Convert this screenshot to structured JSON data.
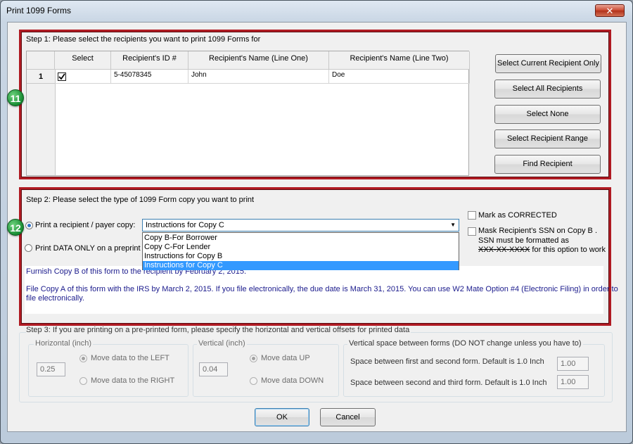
{
  "window": {
    "title": "Print 1099 Forms",
    "close_glyph": "✕"
  },
  "step1": {
    "label": "Step 1: Please select the recipients you want to print 1099 Forms for",
    "columns": [
      "Select",
      "Recipient's ID #",
      "Recipient's Name (Line One)",
      "Recipient's Name (Line Two)"
    ],
    "rows": [
      {
        "number": "1",
        "selected": true,
        "id": "5-45078345",
        "name_line_one": "John",
        "name_line_two": "Doe"
      }
    ],
    "buttons": {
      "select_current": "Select Current Recipient Only",
      "select_all": "Select All Recipients",
      "select_none": "Select None",
      "select_range": "Select Recipient Range",
      "find": "Find Recipient"
    }
  },
  "step2": {
    "label": "Step 2: Please select the type of 1099 Form copy you want to print",
    "print_copy_label": "Print a recipient / payer copy:",
    "print_data_only_label": "Print DATA ONLY on a preprinte",
    "combo_value": "Instructions for Copy C",
    "dropdown_options": [
      "Copy B-For Borrower",
      "Copy C-For Lender",
      "Instructions for Copy B",
      "Instructions for Copy C"
    ],
    "selected_option_index": 3,
    "mark_corrected_label": "Mark as CORRECTED",
    "mask_ssn_label_line1": "Mask Recipient's SSN on Copy B .",
    "mask_ssn_label_line2": "SSN must be formatted as",
    "mask_ssn_label_line3_pattern": "XXX-XX-XXXX",
    "mask_ssn_label_line3_rest": "for this option to work",
    "info_line1": "Furnish Copy B of this form to the recipient by February 2, 2015.",
    "info_line2": "File Copy A of this form with the IRS by March 2, 2015. If you file electronically, the due date is March 31, 2015. You can use W2 Mate Option #4 (Electronic Filing) in order to",
    "info_line3": "file electronically."
  },
  "step3": {
    "label": "Step 3: If you are printing on a pre-printed form, please specify the horizontal and vertical offsets for printed data",
    "horizontal": {
      "title": "Horizontal (inch)",
      "value": "0.25",
      "left_label": "Move data to the LEFT",
      "right_label": "Move data to the RIGHT"
    },
    "vertical": {
      "title": "Vertical (inch)",
      "value": "0.04",
      "up_label": "Move data UP",
      "down_label": "Move data DOWN"
    },
    "spacing": {
      "title": "Vertical space between forms (DO NOT change unless you have to)",
      "first_second_label": "Space between first and second form. Default is 1.0 Inch",
      "first_second_value": "1.00",
      "second_third_label": "Space between second and third form. Default is 1.0 Inch",
      "second_third_value": "1.00"
    }
  },
  "footer": {
    "ok_label": "OK",
    "cancel_label": "Cancel"
  },
  "annotations": {
    "badge_11": "11",
    "badge_12": "12"
  },
  "colors": {
    "highlight_border": "#b01a22",
    "info_text": "#1a1a8c",
    "selection": "#3399ff",
    "badge_green": "#178c32"
  }
}
